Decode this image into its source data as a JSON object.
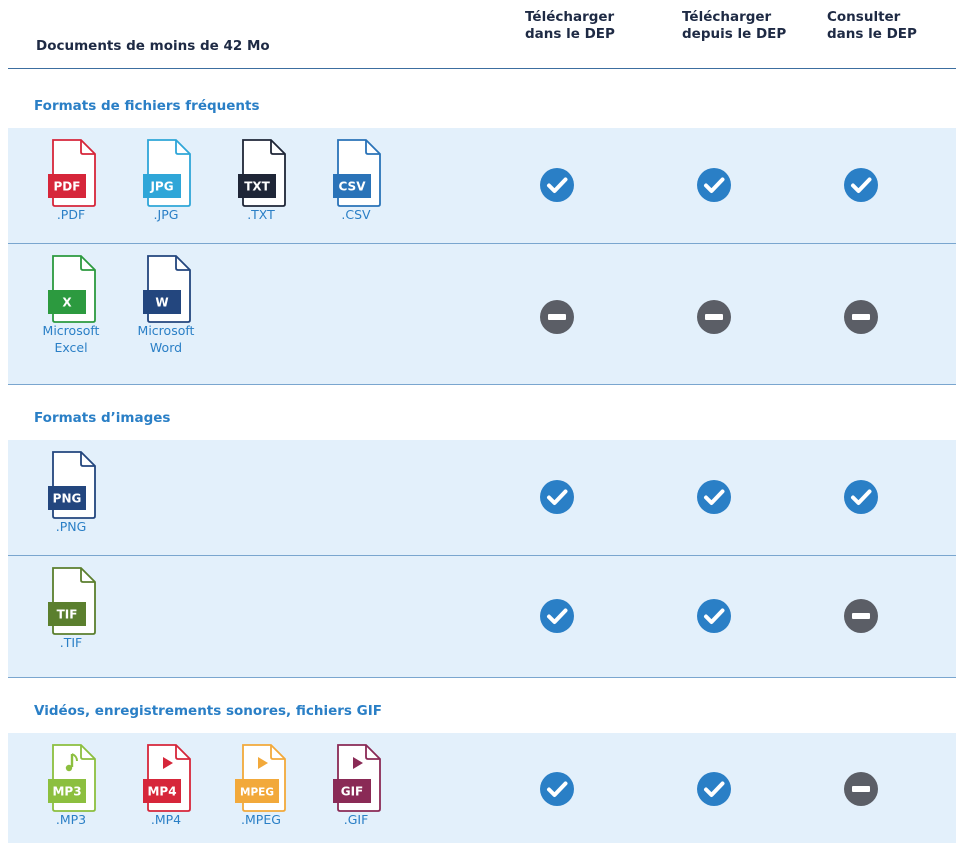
{
  "header": {
    "title": "Documents de moins de 42 Mo",
    "columns": [
      "Télécharger dans le DEP",
      "Télécharger depuis le DEP",
      "Consulter dans le DEP"
    ],
    "columns_lines": [
      [
        "Télécharger",
        "dans le DEP"
      ],
      [
        "Télécharger",
        "depuis le DEP"
      ],
      [
        "Consulter",
        "dans le DEP"
      ]
    ]
  },
  "sections": [
    {
      "label": "Formats de fichiers fréquents",
      "rows": [
        {
          "files": [
            {
              "badge": "PDF",
              "color": "#d6263a",
              "label": ".PDF"
            },
            {
              "badge": "JPG",
              "color": "#2fa6d8",
              "label": ".JPG"
            },
            {
              "badge": "TXT",
              "color": "#1f2637",
              "label": ".TXT"
            },
            {
              "badge": "CSV",
              "color": "#2a73b8",
              "label": ".CSV"
            }
          ],
          "status": [
            "check",
            "check",
            "check"
          ]
        },
        {
          "files": [
            {
              "badge": "X",
              "color": "#2c9a3f",
              "label": "Microsoft Excel",
              "label_lines": [
                "Microsoft",
                "Excel"
              ]
            },
            {
              "badge": "W",
              "color": "#23467e",
              "label": "Microsoft Word",
              "label_lines": [
                "Microsoft",
                "Word"
              ]
            }
          ],
          "status": [
            "dash",
            "dash",
            "dash"
          ]
        }
      ]
    },
    {
      "label": "Formats d’images",
      "rows": [
        {
          "files": [
            {
              "badge": "PNG",
              "color": "#23467e",
              "label": ".PNG"
            }
          ],
          "status": [
            "check",
            "check",
            "check"
          ]
        },
        {
          "files": [
            {
              "badge": "TIF",
              "color": "#5b7f2e",
              "label": ".TIF"
            }
          ],
          "status": [
            "check",
            "check",
            "dash"
          ]
        }
      ]
    },
    {
      "label": "Vidéos, enregistrements sonores, fichiers GIF",
      "rows": [
        {
          "files": [
            {
              "badge": "MP3",
              "color": "#8cbf3f",
              "label": ".MP3",
              "glyph": "note"
            },
            {
              "badge": "MP4",
              "color": "#d6263a",
              "label": ".MP4",
              "glyph": "play"
            },
            {
              "badge": "MPEG",
              "color": "#f2a93b",
              "label": ".MPEG",
              "glyph": "play"
            },
            {
              "badge": "GIF",
              "color": "#8a2a56",
              "label": ".GIF",
              "glyph": "play"
            }
          ],
          "status": [
            "check",
            "check",
            "dash"
          ]
        }
      ]
    }
  ],
  "colors": {
    "check": "#2a7fc6",
    "dash": "#5b5e66",
    "row_bg": "#e3f0fb",
    "section_text": "#2a7fc6",
    "file_label": "#2a7fc6"
  },
  "icons": {
    "check": "check-circle-icon",
    "dash": "minus-circle-icon"
  }
}
